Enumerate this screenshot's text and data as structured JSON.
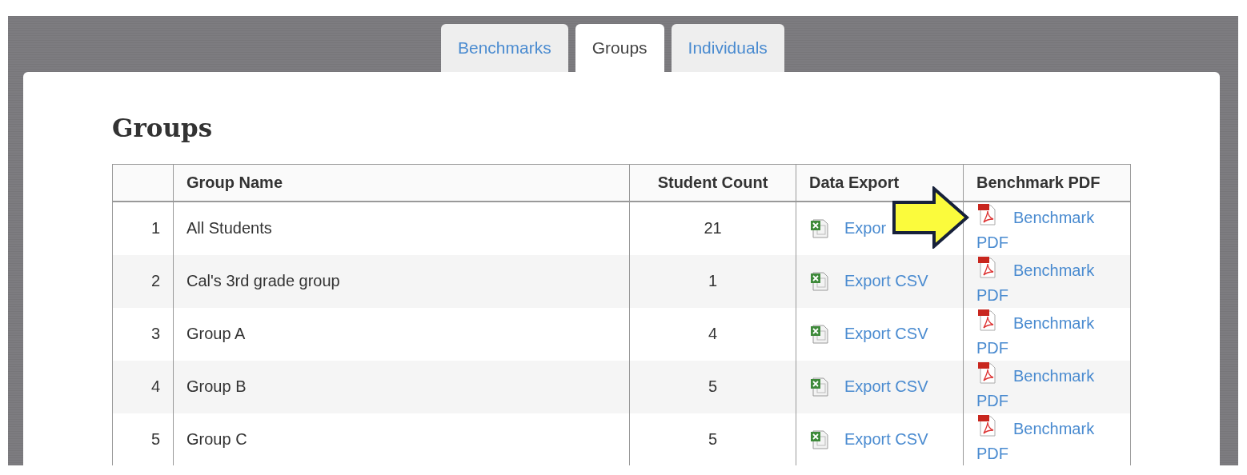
{
  "tabs": [
    {
      "label": "Benchmarks",
      "selected": false
    },
    {
      "label": "Groups",
      "selected": true
    },
    {
      "label": "Individuals",
      "selected": false
    }
  ],
  "heading": "Groups",
  "table": {
    "columns": [
      "Group Name",
      "Student Count",
      "Data Export",
      "Benchmark PDF"
    ],
    "rows": [
      {
        "index": "1",
        "name": "All Students",
        "count": "21",
        "export": "Expor",
        "pdf": "Benchmark PDF",
        "callout": true
      },
      {
        "index": "2",
        "name": "Cal's 3rd grade group",
        "count": "1",
        "export": "Export CSV",
        "pdf": "Benchmark PDF",
        "callout": false
      },
      {
        "index": "3",
        "name": "Group A",
        "count": "4",
        "export": "Export CSV",
        "pdf": "Benchmark PDF",
        "callout": false
      },
      {
        "index": "4",
        "name": "Group B",
        "count": "5",
        "export": "Export CSV",
        "pdf": "Benchmark PDF",
        "callout": false
      },
      {
        "index": "5",
        "name": "Group C",
        "count": "5",
        "export": "Export CSV",
        "pdf": "Benchmark PDF",
        "callout": false
      }
    ]
  }
}
